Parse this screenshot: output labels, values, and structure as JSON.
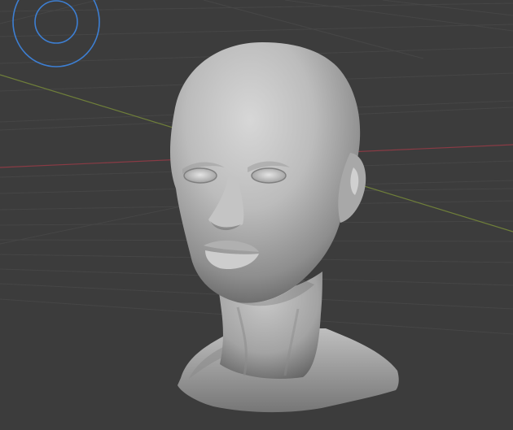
{
  "viewport": {
    "background": "#3c3c3c",
    "grid_color": "#474747",
    "x_axis_color": "#8a3b45",
    "y_axis_color": "#6f7f3a",
    "brush_color": "#3d7fd3",
    "mesh_color": "#b5b5b5"
  },
  "objects": {
    "sculpt": "head-bust-sculpt",
    "brush_cursor": "sculpt-brush-cursor"
  }
}
